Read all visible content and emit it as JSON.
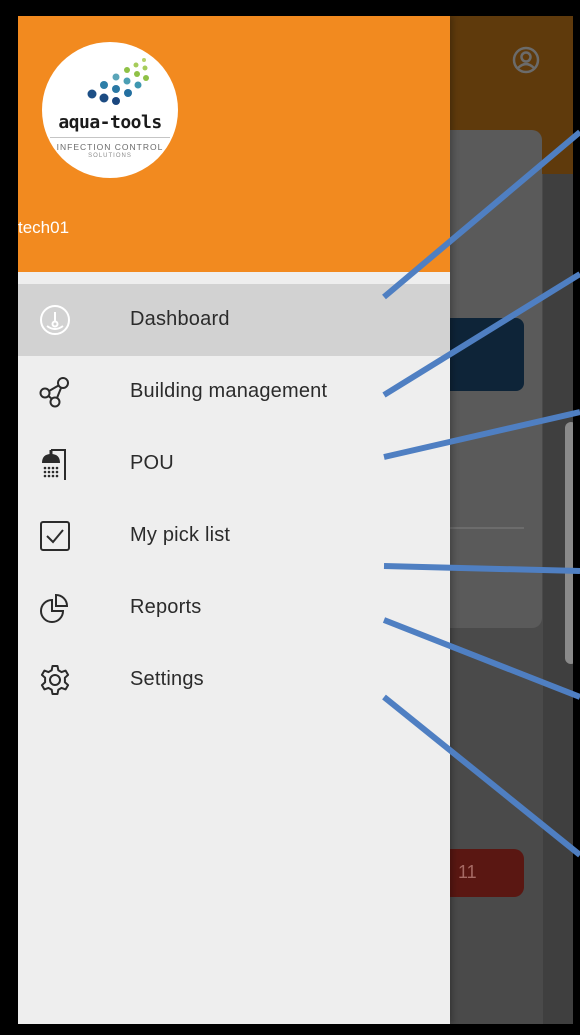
{
  "header": {
    "username": "tech01",
    "logo": {
      "name": "aqua-tools",
      "tagline": "INFECTION CONTROL",
      "subtagline": "SOLUTIONS"
    }
  },
  "menu": {
    "items": [
      {
        "label": "Dashboard",
        "icon": "dashboard-gauge-icon",
        "active": true
      },
      {
        "label": "Building management",
        "icon": "network-nodes-icon",
        "active": false
      },
      {
        "label": "POU",
        "icon": "shower-icon",
        "active": false
      },
      {
        "label": "My pick list",
        "icon": "checkbox-icon",
        "active": false
      },
      {
        "label": "Reports",
        "icon": "pie-chart-icon",
        "active": false
      },
      {
        "label": "Settings",
        "icon": "gear-icon",
        "active": false
      }
    ]
  },
  "background": {
    "badge_number": "11",
    "account_icon": "account-circle-icon"
  },
  "colors": {
    "accent": "#f28a1f",
    "drawer_bg": "#eeeeee",
    "active_item_bg": "#d2d2d2",
    "annotation_line": "#4f7fc2"
  }
}
